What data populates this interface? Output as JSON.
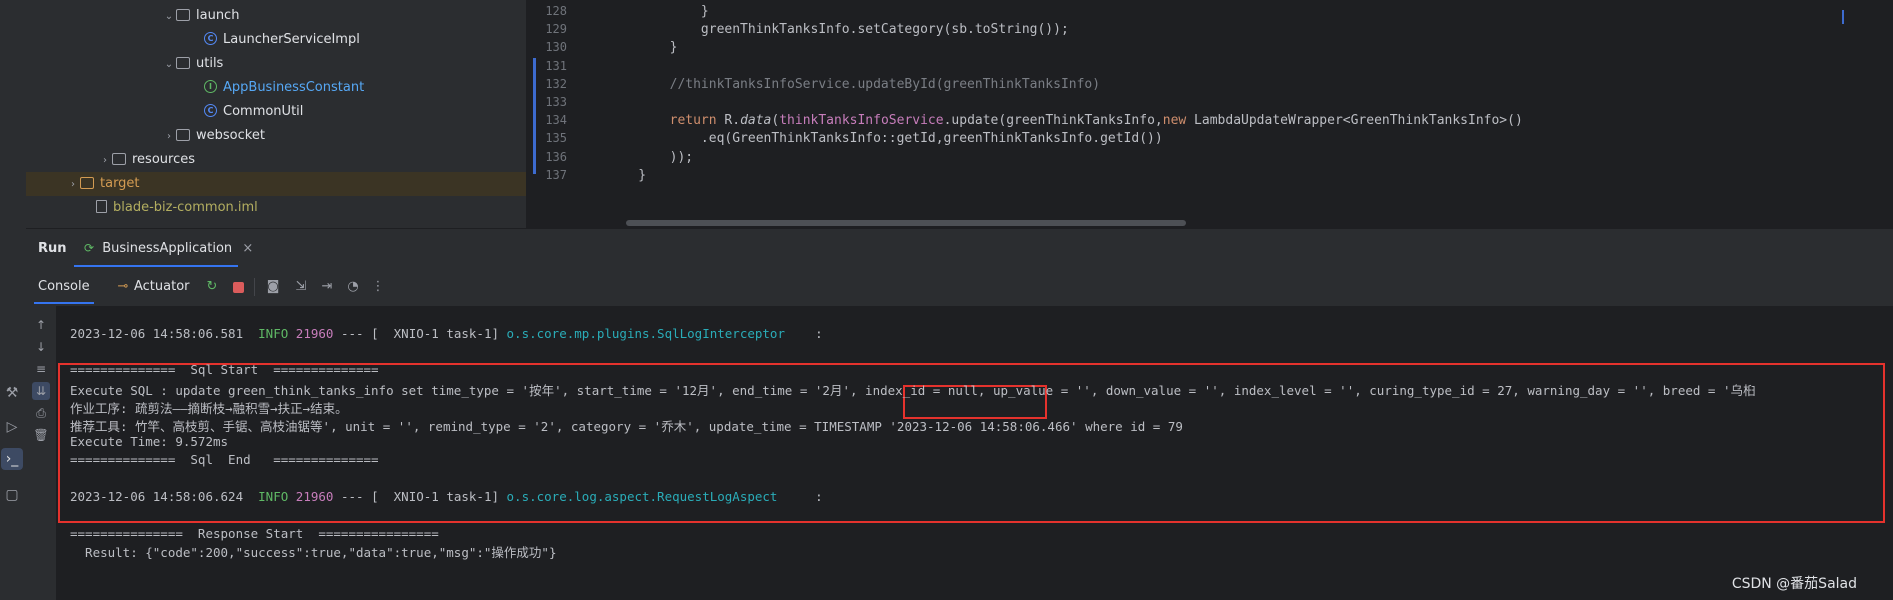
{
  "project_tree": [
    {
      "label": "launch",
      "kind": "folder",
      "indent": 162,
      "chevron": "v"
    },
    {
      "label": "LauncherServiceImpl",
      "kind": "class",
      "indent": 190,
      "chevron": ""
    },
    {
      "label": "utils",
      "kind": "folder",
      "indent": 162,
      "chevron": "v"
    },
    {
      "label": "AppBusinessConstant",
      "kind": "interface",
      "indent": 190,
      "chevron": ""
    },
    {
      "label": "CommonUtil",
      "kind": "class",
      "indent": 190,
      "chevron": ""
    },
    {
      "label": "websocket",
      "kind": "folder",
      "indent": 162,
      "chevron": ">"
    },
    {
      "label": "resources",
      "kind": "folder",
      "indent": 98,
      "chevron": ">"
    },
    {
      "label": "target",
      "kind": "folder-orange",
      "indent": 66,
      "chevron": ">"
    },
    {
      "label": "blade-biz-common.iml",
      "kind": "file",
      "indent": 82,
      "chevron": ""
    }
  ],
  "editor": {
    "line_numbers": [
      "128",
      "129",
      "130",
      "131",
      "132",
      "133",
      "134",
      "135",
      "136",
      "137"
    ],
    "lines": [
      {
        "text": "            }"
      },
      {
        "text": "            greenThinkTanksInfo.setCategory(sb.toString());"
      },
      {
        "text": "        }"
      },
      {
        "text": ""
      },
      {
        "text": "        //thinkTanksInfoService.updateById(greenThinkTanksInfo)"
      },
      {
        "text": ""
      },
      {
        "text": "        return R.data(thinkTanksInfoService.update(greenThinkTanksInfo,new LambdaUpdateWrapper<GreenThinkTanksInfo>()"
      },
      {
        "text": "            .eq(GreenThinkTanksInfo::getId,greenThinkTanksInfo.getId())"
      },
      {
        "text": "        ));"
      },
      {
        "text": "    }"
      }
    ]
  },
  "run_window": {
    "title": "Run",
    "config_tab": "BusinessApplication",
    "close_glyph": "×",
    "toolbar": {
      "console": "Console",
      "actuator": "Actuator"
    }
  },
  "console": {
    "log1": {
      "timestamp": "2023-12-06 14:58:06.581",
      "level": "INFO",
      "pid": "21960",
      "thread": " --- [  XNIO-1 task-1] ",
      "logger": "o.s.core.mp.plugins.SqlLogInterceptor",
      "tail": "    :"
    },
    "sql_start": "==============  Sql Start  ==============",
    "sql_exec_a": "Execute SQL : update green_think_tanks_info set time_type = '按年', start_time = '12月', end_time = '2月', ",
    "sql_exec_b": "index_id = null,",
    "sql_exec_c": " up_value = '', down_value = '', index_level = '', curing_type_id = 27, warning_day = '', breed = '乌桕",
    "sql_line2": "作业工序: 疏剪法——摘断枝→融积雪→扶正→结束。",
    "sql_line3": "推荐工具: 竹竿、高枝剪、手锯、高枝油锯等', unit = '', remind_type = '2', category = '乔木', update_time = TIMESTAMP '2023-12-06 14:58:06.466' where id = 79",
    "exec_time": "Execute Time: 9.572ms",
    "sql_end": "==============  Sql  End   ==============",
    "log2": {
      "timestamp": "2023-12-06 14:58:06.624",
      "level": "INFO",
      "pid": "21960",
      "thread": " --- [  XNIO-1 task-1] ",
      "logger": "o.s.core.log.aspect.RequestLogAspect",
      "tail": "     :"
    },
    "response_start": "===============  Response Start  ================",
    "cut_line": "  Result: {\"code\":200,\"success\":true,\"data\":true,\"msg\":\"操作成功\"}"
  },
  "watermark": "CSDN @番茄Salad",
  "colors": {
    "highlight_border": "#e5322d",
    "accent": "#3d6bcf"
  }
}
